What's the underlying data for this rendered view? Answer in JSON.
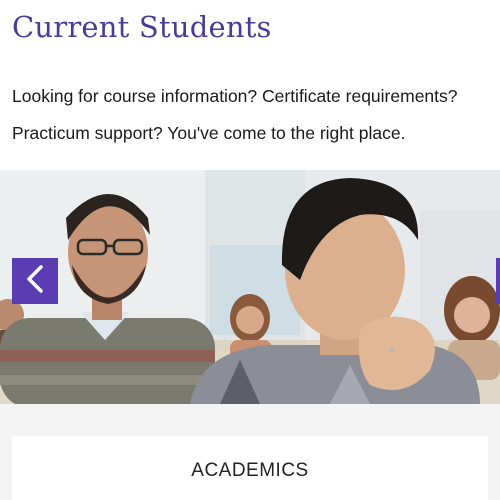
{
  "header": {
    "title": "Current Students"
  },
  "intro": {
    "text": "Looking for course information? Certificate requirements? Practicum support? You've come to the right place."
  },
  "carousel": {
    "prev_icon": "chevron-left-icon",
    "next_icon": "chevron-right-icon",
    "accent_color": "#5a3db3"
  },
  "sections": [
    {
      "title": "ACADEMICS"
    }
  ],
  "colors": {
    "title": "#4b3b93",
    "text": "#1a1a1a",
    "section_bg": "#f4f4f4"
  }
}
